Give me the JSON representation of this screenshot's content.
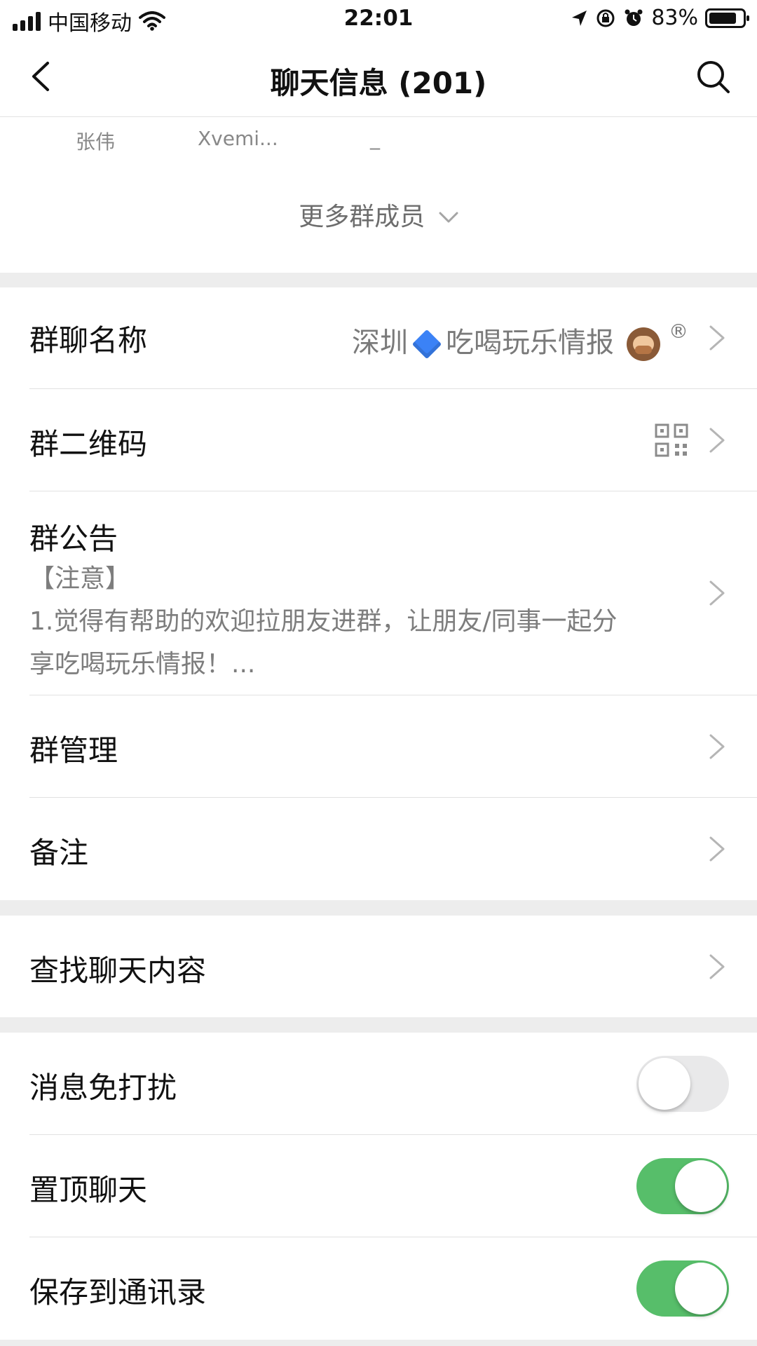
{
  "status_bar": {
    "carrier": "中国移动",
    "time": "22:01",
    "battery": "83%",
    "battery_level": 0.83,
    "icons": [
      "signal-icon",
      "wifi-icon",
      "location-icon",
      "rotation-lock-icon",
      "alarm-icon",
      "battery-icon"
    ]
  },
  "nav": {
    "title": "聊天信息 (201)",
    "icons": [
      "back-icon",
      "search-icon"
    ]
  },
  "members": {
    "names": [
      "张伟",
      "Xvemi...",
      "_"
    ],
    "more_label": "更多群成员"
  },
  "group_name": {
    "label": "群聊名称",
    "value_part1": "深圳",
    "value_part2": "吃喝玩乐情报",
    "reg_mark": "®"
  },
  "qr": {
    "label": "群二维码"
  },
  "notice": {
    "label": "群公告",
    "line1": "【注意】",
    "line2": "1.觉得有帮助的欢迎拉朋友进群，让朋友/同事一起分",
    "line3": "享吃喝玩乐情报！..."
  },
  "manage": {
    "label": "群管理"
  },
  "remark": {
    "label": "备注"
  },
  "search_chat": {
    "label": "查找聊天内容"
  },
  "toggles": {
    "mute": {
      "label": "消息免打扰",
      "on": false
    },
    "pin": {
      "label": "置顶聊天",
      "on": true
    },
    "save_contacts": {
      "label": "保存到通讯录",
      "on": true
    }
  },
  "colors": {
    "background": "#ededed",
    "toggle_on": "#57be6a",
    "toggle_off": "#e9e9ea",
    "secondary_text": "#7d7d7d"
  }
}
